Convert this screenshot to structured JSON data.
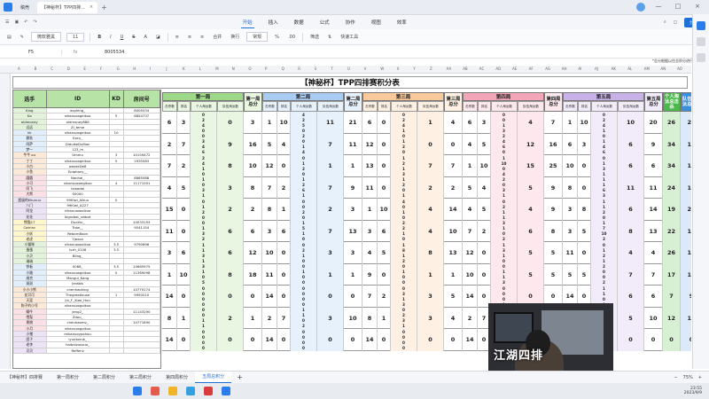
{
  "titlebar": {
    "tabs": [
      {
        "label": "稿壳"
      },
      {
        "label": "【神秘杯】TPP四排..."
      }
    ]
  },
  "menu": {
    "items": [
      "开始",
      "插入",
      "数据",
      "公式",
      "协作",
      "视图",
      "效率"
    ],
    "active": "开始",
    "share": "分享"
  },
  "ribbon": {
    "font": "微软雅黑",
    "size": "11",
    "merge": "合并",
    "wrap": "换行",
    "format": "常规",
    "filter": "筛选",
    "quick": "快速工具"
  },
  "formula": {
    "cell": "F5",
    "value": "8005534"
  },
  "note": "*总分根据以往总积分进行总结",
  "sheet_title": "【神秘杯】TPP四排赛积分表",
  "left_table": {
    "headers": [
      "选手",
      "ID",
      "KD",
      "房间号"
    ],
    "rows": [
      [
        "King",
        "aoyking_",
        "",
        "8005534"
      ],
      [
        "Ka",
        "nikanuoxgeikuo",
        "5",
        "6854737"
      ],
      [
        "oldmoney",
        "oldmoney888",
        "",
        ""
      ],
      [
        "远远",
        "ZI_terse",
        "",
        ""
      ],
      [
        "kk",
        "nikanuoxgeikuo",
        "10",
        ""
      ],
      [
        "赖秋",
        "Epcy_",
        "",
        ""
      ],
      [
        "阿萨",
        "DiduikeDuMan",
        "",
        ""
      ],
      [
        "梦一",
        "123_m",
        "",
        ""
      ],
      [
        "牛牛 ou",
        "Ummu",
        "3",
        "10159472"
      ],
      [
        "丁丁",
        "nikanuoxgeikuo",
        "5",
        "2935583"
      ],
      [
        "小白",
        "owezkDe8",
        "",
        ""
      ],
      [
        "小鱼",
        "Epiphany__",
        "",
        ""
      ],
      [
        "圆圆",
        "Nanhai_",
        "",
        "8865588"
      ],
      [
        "小可",
        "nikanuoxoegikuo",
        "4",
        "11171001"
      ],
      [
        "阿飞",
        "lxiaodai",
        "",
        ""
      ],
      [
        "大熊",
        "S0000",
        "",
        ""
      ],
      [
        "超级的Kkuuuu",
        "99Kiwi_Aikuu",
        "0",
        ""
      ],
      [
        "八门",
        "99Kiwi_A227",
        "",
        ""
      ],
      [
        "阿龙",
        "nikanuoxoxikuo",
        "",
        ""
      ],
      [
        "花花",
        "bigrobot_rotbot",
        "",
        ""
      ],
      [
        "熊猫17",
        "DuoYor_",
        "",
        "10033193"
      ],
      [
        "Catrinc",
        "Trow__",
        "",
        "9541154"
      ],
      [
        "小妖",
        "RebornBoon",
        "",
        ""
      ],
      [
        "老虎",
        "7Jaxon",
        "",
        ""
      ],
      [
        "小猫咪",
        "nikanuoxoxikuo",
        "3.5",
        "9790896"
      ],
      [
        "蛋蛋",
        "Iyzh_0106",
        "3.5",
        ""
      ],
      [
        "小贝",
        "Bling_",
        "",
        ""
      ],
      [
        "瑞瑞",
        "",
        "",
        ""
      ],
      [
        "铁板",
        "0088_",
        "3.5",
        "10685975"
      ],
      [
        "小路",
        "nikanuoxgoikuo",
        "5",
        "11369098"
      ],
      [
        "维克",
        "Mangui_Kang",
        "",
        ""
      ],
      [
        "斑斑",
        "Jerabis",
        "",
        ""
      ],
      [
        "小小小熊",
        "chenhaoking",
        "",
        "10770174"
      ],
      [
        "花可可",
        "Thegreatlouse",
        "1",
        "9950010"
      ],
      [
        "天涯",
        "Jin_F_Xiao_Hun",
        "",
        ""
      ],
      [
        "狗子的小号",
        "nikanuoxgoikuo",
        "",
        ""
      ],
      [
        "蜗牛",
        "Jeng2_",
        "",
        "11143290"
      ],
      [
        "雪梨",
        "Zdou_",
        "",
        ""
      ],
      [
        "黑桃",
        "chenhaomv_",
        "",
        "10771890"
      ],
      [
        "小月",
        "nikanuoxgoikuo",
        "",
        ""
      ],
      [
        "小猪",
        "mikanuoypohou",
        "",
        ""
      ],
      [
        "团子",
        "lyunkoruk_",
        "",
        ""
      ],
      [
        "老李",
        "haibaizuozuo_",
        "",
        ""
      ],
      [
        "贝贝",
        "Reffenz",
        "",
        ""
      ]
    ]
  },
  "score_header": {
    "stages": [
      "第一局",
      "第二局",
      "第三局",
      "第四局",
      "第五局"
    ],
    "stage_totals": [
      "第一局总分",
      "第二局总分",
      "第三局总分",
      "第四局总分",
      "第五局总分"
    ],
    "sub": [
      "击杀数",
      "排名",
      "个人淘汰数",
      "队伍淘汰数"
    ],
    "finals": [
      "个人淘汰总击杀",
      "队伍总淘汰总击杀",
      "队伍总淘汰",
      "总分",
      "排名"
    ]
  },
  "score_rows": [
    {
      "s1": [
        "6",
        "3",
        "0|2|4|0",
        "0"
      ],
      "t1": "3",
      "s2": [
        "1",
        "10",
        "4|2|5|0",
        "11"
      ],
      "t2": "21",
      "s3": [
        "6",
        "0",
        "0|2|4|1",
        "1"
      ],
      "t3": "4",
      "s4": [
        "6",
        "3",
        "0|0|1|3",
        "4"
      ],
      "t4": "7",
      "s5": [
        "1",
        "10",
        "0|2|4|1",
        "10"
      ],
      "t5": "20",
      "f": [
        "26",
        "29",
        "55",
        "1"
      ]
    },
    {
      "s1": [
        "2",
        "7",
        "0|3|4|6",
        "9"
      ],
      "t1": "16",
      "s2": [
        "5",
        "4",
        "2|0|1|4",
        "7"
      ],
      "t2": "11",
      "s3": [
        "12",
        "0",
        "0|1|2|0",
        "0"
      ],
      "t3": "0",
      "s4": [
        "4",
        "5",
        "2|4|6|0",
        "12"
      ],
      "t4": "16",
      "s5": [
        "6",
        "3",
        "0|1|4|6",
        "6"
      ],
      "t5": "9",
      "f": [
        "34",
        "15",
        "49",
        "2"
      ]
    },
    {
      "s1": [
        "7",
        "2",
        "2|4|1|0",
        "8"
      ],
      "t1": "10",
      "s2": [
        "12",
        "0",
        "0|1|2|0",
        "1"
      ],
      "t2": "1",
      "s3": [
        "13",
        "0",
        "1|2|1|3",
        "7"
      ],
      "t3": "7",
      "s4": [
        "1",
        "10",
        "1|10|0|4",
        "15"
      ],
      "t4": "25",
      "s5": [
        "10",
        "0",
        "0|1|3|1",
        "6"
      ],
      "t5": "6",
      "f": [
        "34",
        "12",
        "46",
        "3"
      ]
    },
    {
      "s1": [
        "4",
        "5",
        "1|0|3|1",
        "3"
      ],
      "t1": "8",
      "s2": [
        "7",
        "2",
        "1|2|6|1",
        "7"
      ],
      "t2": "9",
      "s3": [
        "11",
        "0",
        "1|2|0|1",
        "2"
      ],
      "t3": "2",
      "s4": [
        "5",
        "4",
        "2|0|3|1",
        "5"
      ],
      "t4": "9",
      "s5": [
        "8",
        "0",
        "1|1|6|3",
        "11"
      ],
      "t5": "11",
      "f": [
        "24",
        "18",
        "42",
        "4"
      ]
    },
    {
      "s1": [
        "15",
        "0",
        "0|1|2|0",
        "2"
      ],
      "t1": "2",
      "s2": [
        "8",
        "1",
        "0|0|2|0",
        "2"
      ],
      "t2": "3",
      "s3": [
        "1",
        "10",
        "4|0|1|0",
        "4"
      ],
      "t3": "14",
      "s4": [
        "4",
        "5",
        "0|2|1|1",
        "4"
      ],
      "t4": "9",
      "s5": [
        "3",
        "8",
        "1|1|2|0",
        "6"
      ],
      "t5": "14",
      "f": [
        "19",
        "22",
        "41",
        "5"
      ]
    },
    {
      "s1": [
        "11",
        "0",
        "0|1|3|2",
        "6"
      ],
      "t1": "6",
      "s2": [
        "3",
        "6",
        "1|5|1|0",
        "7"
      ],
      "t2": "13",
      "s3": [
        "3",
        "6",
        "2|2|1|0",
        "4"
      ],
      "t3": "10",
      "s4": [
        "7",
        "2",
        "3|1|0|2",
        "6"
      ],
      "t4": "8",
      "s5": [
        "3",
        "5",
        "1|7|10|2",
        "8"
      ],
      "t5": "13",
      "f": [
        "22",
        "17",
        "39",
        "6"
      ]
    },
    {
      "s1": [
        "3",
        "6",
        "1|1|3|1",
        "6"
      ],
      "t1": "12",
      "s2": [
        "10",
        "0",
        "0|2|1|0",
        "3"
      ],
      "t2": "3",
      "s3": [
        "4",
        "5",
        "1|8|1|2",
        "8"
      ],
      "t3": "13",
      "s4": [
        "12",
        "0",
        "1|3|1|0",
        "5"
      ],
      "t4": "5",
      "s5": [
        "11",
        "0",
        "0|1|2|1",
        "4"
      ],
      "t5": "4",
      "f": [
        "26",
        "11",
        "37",
        "7"
      ]
    },
    {
      "s1": [
        "1",
        "10",
        "3|1|0|5",
        "8"
      ],
      "t1": "18",
      "s2": [
        "11",
        "0",
        "0|1|0|0",
        "1"
      ],
      "t2": "1",
      "s3": [
        "9",
        "0",
        "0|1|0|0",
        "1"
      ],
      "t3": "1",
      "s4": [
        "10",
        "0",
        "0|1|1|3",
        "5"
      ],
      "t4": "5",
      "s5": [
        "5",
        "5",
        "2|0|0|2",
        "7"
      ],
      "t5": "7",
      "f": [
        "17",
        "15",
        "32",
        "8"
      ]
    },
    {
      "s1": [
        "14",
        "0",
        "0|0|0|0",
        "0"
      ],
      "t1": "0",
      "s2": [
        "14",
        "0",
        "0|0|0|0",
        "0"
      ],
      "t2": "0",
      "s3": [
        "7",
        "2",
        "0|3|1|3",
        "3"
      ],
      "t3": "5",
      "s4": [
        "14",
        "0",
        "0|0|0|0",
        "0"
      ],
      "t4": "0",
      "s5": [
        "14",
        "0",
        "1|1|0|0",
        "6"
      ],
      "t5": "6",
      "f": [
        "7",
        "9",
        "26",
        "9"
      ]
    },
    {
      "s1": [
        "8",
        "1",
        "0|0|1|1",
        "2"
      ],
      "t1": "1",
      "s2": [
        "2",
        "7",
        "1|1|0|2",
        "3"
      ],
      "t2": "10",
      "s3": [
        "8",
        "1",
        "0|2|3|1",
        "3"
      ],
      "t3": "4",
      "s4": [
        "2",
        "7",
        "3|1|0|0",
        "4"
      ],
      "t4": "11",
      "s5": [
        "4",
        "5",
        "1|2|2|1",
        "5"
      ],
      "t5": "10",
      "f": [
        "12",
        "12",
        "27",
        "10"
      ]
    },
    {
      "s1": [
        "14",
        "0",
        "0|0|0|0",
        "0"
      ],
      "t1": "0",
      "s2": [
        "14",
        "0",
        "0|0|0|0",
        "0"
      ],
      "t2": "0",
      "s3": [
        "14",
        "0",
        "0|0|0|0",
        "0"
      ],
      "t3": "0",
      "s4": [
        "14",
        "0",
        "0|0|0|0",
        "0"
      ],
      "t4": "0",
      "s5": [
        "14",
        "0",
        "0|0|0|0",
        "0"
      ],
      "t5": "0",
      "f": [
        "0",
        "0",
        "0",
        "11"
      ]
    }
  ],
  "sheet_tabs": [
    "【神秘杯】四排赛",
    "第一局积分",
    "第二局积分",
    "第三局积分",
    "第四局积分",
    "五局总积分"
  ],
  "active_sheet": "五局总积分",
  "zoom": "75%",
  "webcam_text": "江湖四排",
  "clock": {
    "time": "23:55",
    "date": "2023/9/9"
  }
}
